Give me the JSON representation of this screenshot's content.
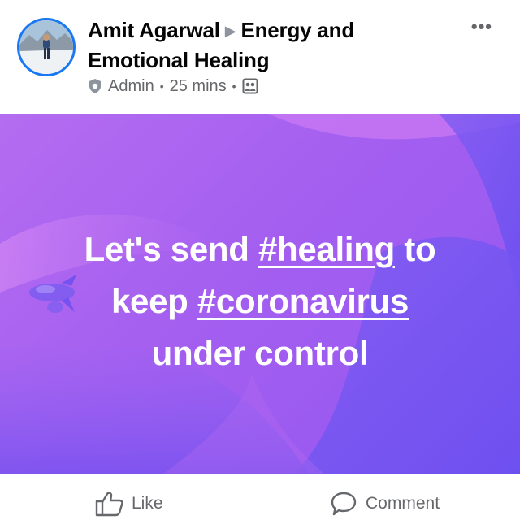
{
  "post": {
    "author": "Amit Agarwal",
    "group": "Energy and Emotional Healing",
    "group_line1": "Energy and",
    "group_line2": "Emotional Healing",
    "role": "Admin",
    "time": "25 mins",
    "more_icon": "more-horizontal-icon",
    "text_line1_pre": "Let's send ",
    "hashtag1": "#healing",
    "text_line1_post": " to",
    "text_line2_pre": "keep ",
    "hashtag2": "#coronavirus",
    "text_line3": "under control"
  },
  "actions": {
    "like_label": "Like",
    "comment_label": "Comment"
  },
  "colors": {
    "brand_blue": "#1877f2",
    "background_purple": "#a45ff0",
    "meta_gray": "#65676b"
  }
}
